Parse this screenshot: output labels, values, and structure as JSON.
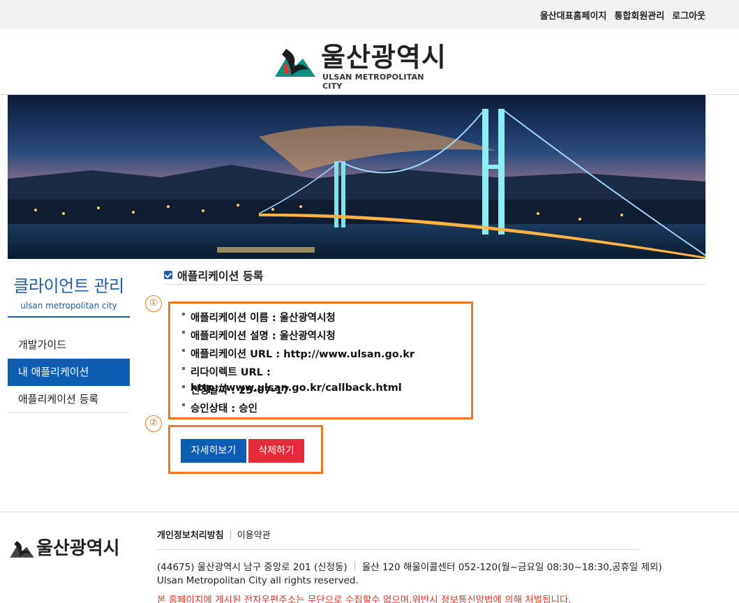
{
  "topbar": {
    "links": [
      "울산대표홈페이지",
      "통합회원관리",
      "로그아웃"
    ]
  },
  "header": {
    "logo_ko": "울산광역시",
    "logo_en": "ULSAN METROPOLITAN CITY",
    "logo_colors": {
      "teal": "#0e8f86",
      "red": "#d93a2b",
      "dark": "#1e1e1e"
    }
  },
  "sidebar": {
    "title": "클라이언트 관리",
    "subtitle": "ulsan metropolitan city",
    "items": [
      {
        "label": "개발가이드",
        "active": false
      },
      {
        "label": "내 애플리케이션",
        "active": true
      },
      {
        "label": "애플리케이션 등록",
        "active": false
      }
    ]
  },
  "main": {
    "section_title": "애플리케이션 등록",
    "markers": [
      "①",
      "②"
    ],
    "info": [
      "애플리케이션 이름 : 울산광역시청",
      "애플리케이션 설명 : 울산광역시청",
      "애플리케이션 URL : http://www.ulsan.go.kr",
      "리다이렉트 URL : http://www.ulsan.go.kr/callback.html",
      "신청날짜 : 25-07-17",
      "승인상태 : 승인"
    ],
    "buttons": {
      "detail": "자세히보기",
      "delete": "삭제하기"
    },
    "highlight_color": "#f07822"
  },
  "footer": {
    "logo_ko": "울산광역시",
    "links": [
      "개인정보처리방침",
      "이용약관"
    ],
    "address": "(44675) 울산광역시 남구 중앙로 201 (신정동)",
    "callcenter": "울산 120 해울이콜센터 052-120(월~금요일 08:30~18:30,공휴일 제외)",
    "copyright": "Ulsan Metropolitan City all rights reserved.",
    "warning": "본 홈페이지에 게시된 전자우편주소는 무단으로 수집할수 없으며,위반시 정보통신망법에 의해 처벌됩니다."
  }
}
